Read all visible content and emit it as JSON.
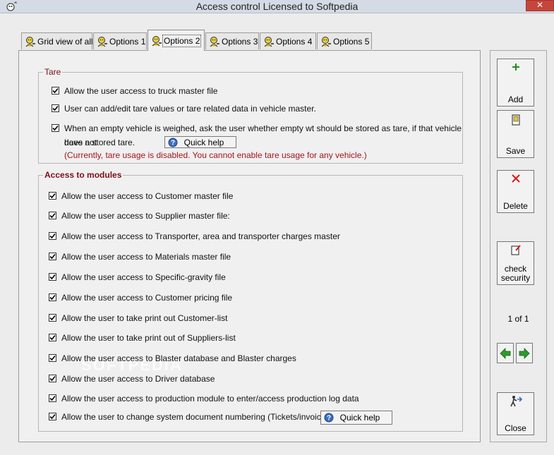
{
  "window": {
    "title": "Access control  Licensed to Softpedia",
    "close_label": "✕"
  },
  "tabs": [
    {
      "label": "Grid view of all"
    },
    {
      "label": "Options 1"
    },
    {
      "label": "Options 2"
    },
    {
      "label": "Options 3"
    },
    {
      "label": "Options 4"
    },
    {
      "label": "Options 5"
    }
  ],
  "tare": {
    "legend": "Tare",
    "items": [
      {
        "label": "Allow the user access to truck master file",
        "checked": true
      },
      {
        "label": "User can add/edit tare values or tare related data in vehicle master.",
        "checked": true
      },
      {
        "label": "When an empty vehicle is weighed, ask the user whether empty wt should be stored as tare, if that vehicle does not",
        "label2": "have a stored tare.",
        "checked": true
      }
    ],
    "quick_help": "Quick help",
    "note": "(Currently, tare usage is disabled. You cannot enable tare usage for any vehicle.)"
  },
  "modules": {
    "legend": "Access to modules",
    "items": [
      {
        "label": "Allow the user access to Customer master file",
        "checked": true
      },
      {
        "label": "Allow the user access to Supplier master file:",
        "checked": true
      },
      {
        "label": "Allow the user access to Transporter, area  and transporter charges master",
        "checked": true
      },
      {
        "label": "Allow the user access to Materials master file",
        "checked": true
      },
      {
        "label": "Allow the user access to Specific-gravity file",
        "checked": true
      },
      {
        "label": "Allow the user access to Customer pricing file",
        "checked": true
      },
      {
        "label": "Allow the user to take print out Customer-list",
        "checked": true
      },
      {
        "label": "Allow the user to take print out of Suppliers-list",
        "checked": true
      },
      {
        "label": "Allow the user access to Blaster database and Blaster charges",
        "checked": true
      },
      {
        "label": "Allow the user access to Driver database",
        "checked": true
      },
      {
        "label": "Allow the user access to production module to enter/access production log data",
        "checked": true
      },
      {
        "label": "Allow the user to change system document numbering (Tickets/invoice etc.)",
        "checked": true
      }
    ],
    "quick_help": "Quick help"
  },
  "sidebar": {
    "add_label": "Add",
    "save_label": "Save",
    "delete_label": "Delete",
    "check_security_line1": "check",
    "check_security_line2": "security",
    "page_indicator": "1 of 1",
    "close_label": "Close"
  },
  "watermark": "SOFTPEDIA",
  "colors": {
    "legend_red": "#7a1018",
    "note_red": "#a3161d",
    "nav_green": "#2e9b2e",
    "delete_red": "#d11a1a",
    "close_red": "#c7453b"
  }
}
